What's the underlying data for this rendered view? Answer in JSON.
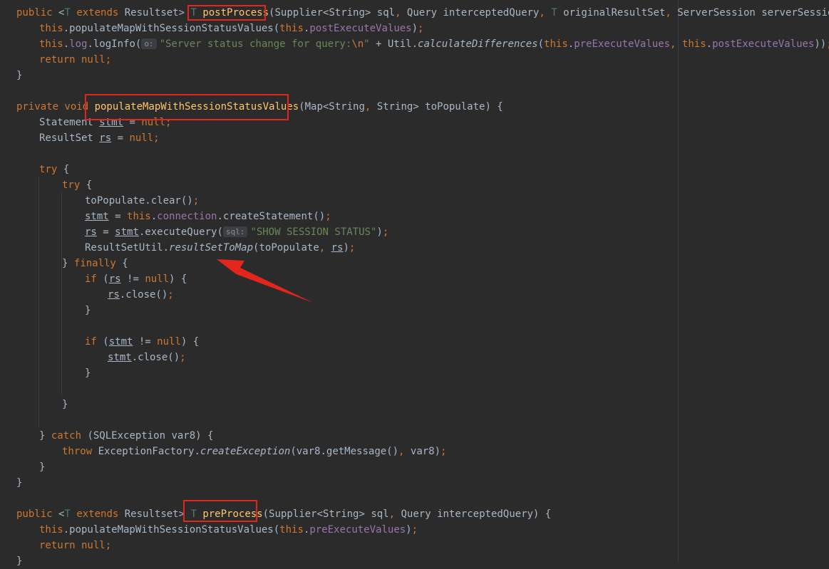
{
  "editor": {
    "lines": [
      {
        "indent": 0,
        "segments": [
          {
            "t": "public ",
            "c": "kw"
          },
          {
            "t": "<",
            "c": ""
          },
          {
            "t": "T",
            "c": "typeparam"
          },
          {
            "t": " extends ",
            "c": "kw"
          },
          {
            "t": "Resultset> ",
            "c": ""
          },
          {
            "t": "T ",
            "c": "typeparam"
          },
          {
            "t": "postProcess",
            "c": "fn"
          },
          {
            "t": "(Supplier<String> sql",
            "c": ""
          },
          {
            "t": ", ",
            "c": "kw"
          },
          {
            "t": "Query interceptedQuery",
            "c": ""
          },
          {
            "t": ", ",
            "c": "kw"
          },
          {
            "t": "T ",
            "c": "typeparam"
          },
          {
            "t": "originalResultSet",
            "c": ""
          },
          {
            "t": ", ",
            "c": "kw"
          },
          {
            "t": "ServerSession serverSession) {",
            "c": ""
          }
        ]
      },
      {
        "indent": 1,
        "segments": [
          {
            "t": "this",
            "c": "kw"
          },
          {
            "t": ".populateMapWithSessionStatusValues(",
            "c": ""
          },
          {
            "t": "this",
            "c": "kw"
          },
          {
            "t": ".",
            "c": ""
          },
          {
            "t": "postExecuteValues",
            "c": "field"
          },
          {
            "t": ")",
            "c": ""
          },
          {
            "t": ";",
            "c": "kw"
          }
        ]
      },
      {
        "indent": 1,
        "segments": [
          {
            "t": "this",
            "c": "kw"
          },
          {
            "t": ".",
            "c": ""
          },
          {
            "t": "log",
            "c": "field"
          },
          {
            "t": ".logInfo(",
            "c": ""
          },
          {
            "t": "o:",
            "c": "hint"
          },
          {
            "t": "\"Server status change for query:",
            "c": "str"
          },
          {
            "t": "\\n",
            "c": "esc"
          },
          {
            "t": "\"",
            "c": "str"
          },
          {
            "t": " + Util.",
            "c": ""
          },
          {
            "t": "calculateDifferences",
            "c": "italic"
          },
          {
            "t": "(",
            "c": ""
          },
          {
            "t": "this",
            "c": "kw"
          },
          {
            "t": ".",
            "c": ""
          },
          {
            "t": "preExecuteValues",
            "c": "field"
          },
          {
            "t": ", ",
            "c": "kw"
          },
          {
            "t": "this",
            "c": "kw"
          },
          {
            "t": ".",
            "c": ""
          },
          {
            "t": "postExecuteValues",
            "c": "field"
          },
          {
            "t": "))",
            "c": ""
          },
          {
            "t": ";",
            "c": "kw"
          }
        ]
      },
      {
        "indent": 1,
        "segments": [
          {
            "t": "return null",
            "c": "kw"
          },
          {
            "t": ";",
            "c": "kw"
          }
        ]
      },
      {
        "indent": 0,
        "segments": [
          {
            "t": "}",
            "c": ""
          }
        ]
      },
      {
        "indent": 0,
        "segments": []
      },
      {
        "indent": 0,
        "segments": [
          {
            "t": "private void ",
            "c": "kw"
          },
          {
            "t": "populateMapWithSessionStatusValues",
            "c": "fn"
          },
          {
            "t": "(Map<String",
            "c": ""
          },
          {
            "t": ", ",
            "c": "kw"
          },
          {
            "t": "String> toPopulate) {",
            "c": ""
          }
        ]
      },
      {
        "indent": 1,
        "segments": [
          {
            "t": "Statement ",
            "c": ""
          },
          {
            "t": "stmt",
            "c": "u"
          },
          {
            "t": " = ",
            "c": ""
          },
          {
            "t": "null",
            "c": "kw"
          },
          {
            "t": ";",
            "c": "kw"
          }
        ]
      },
      {
        "indent": 1,
        "segments": [
          {
            "t": "ResultSet ",
            "c": ""
          },
          {
            "t": "rs",
            "c": "u"
          },
          {
            "t": " = ",
            "c": ""
          },
          {
            "t": "null",
            "c": "kw"
          },
          {
            "t": ";",
            "c": "kw"
          }
        ]
      },
      {
        "indent": 0,
        "segments": []
      },
      {
        "indent": 1,
        "segments": [
          {
            "t": "try ",
            "c": "kw"
          },
          {
            "t": "{",
            "c": ""
          }
        ]
      },
      {
        "indent": 2,
        "segments": [
          {
            "t": "try ",
            "c": "kw"
          },
          {
            "t": "{",
            "c": ""
          }
        ]
      },
      {
        "indent": 3,
        "segments": [
          {
            "t": "toPopulate.clear()",
            "c": ""
          },
          {
            "t": ";",
            "c": "kw"
          }
        ]
      },
      {
        "indent": 3,
        "segments": [
          {
            "t": "stmt",
            "c": "u"
          },
          {
            "t": " = ",
            "c": ""
          },
          {
            "t": "this",
            "c": "kw"
          },
          {
            "t": ".",
            "c": ""
          },
          {
            "t": "connection",
            "c": "field"
          },
          {
            "t": ".createStatement()",
            "c": ""
          },
          {
            "t": ";",
            "c": "kw"
          }
        ]
      },
      {
        "indent": 3,
        "segments": [
          {
            "t": "rs",
            "c": "u"
          },
          {
            "t": " = ",
            "c": ""
          },
          {
            "t": "stmt",
            "c": "u"
          },
          {
            "t": ".executeQuery(",
            "c": ""
          },
          {
            "t": "sql:",
            "c": "hint"
          },
          {
            "t": "\"SHOW SESSION STATUS\"",
            "c": "str"
          },
          {
            "t": ")",
            "c": ""
          },
          {
            "t": ";",
            "c": "kw"
          }
        ]
      },
      {
        "indent": 3,
        "segments": [
          {
            "t": "ResultSetUtil.",
            "c": ""
          },
          {
            "t": "resultSetToMap",
            "c": "italic"
          },
          {
            "t": "(toPopulate",
            "c": ""
          },
          {
            "t": ", ",
            "c": "kw"
          },
          {
            "t": "rs",
            "c": "u"
          },
          {
            "t": ")",
            "c": ""
          },
          {
            "t": ";",
            "c": "kw"
          }
        ]
      },
      {
        "indent": 2,
        "segments": [
          {
            "t": "} ",
            "c": ""
          },
          {
            "t": "finally ",
            "c": "kw"
          },
          {
            "t": "{",
            "c": ""
          }
        ]
      },
      {
        "indent": 3,
        "segments": [
          {
            "t": "if ",
            "c": "kw"
          },
          {
            "t": "(",
            "c": ""
          },
          {
            "t": "rs",
            "c": "u"
          },
          {
            "t": " != ",
            "c": ""
          },
          {
            "t": "null",
            "c": "kw"
          },
          {
            "t": ") {",
            "c": ""
          }
        ]
      },
      {
        "indent": 4,
        "segments": [
          {
            "t": "rs",
            "c": "u"
          },
          {
            "t": ".close()",
            "c": ""
          },
          {
            "t": ";",
            "c": "kw"
          }
        ]
      },
      {
        "indent": 3,
        "segments": [
          {
            "t": "}",
            "c": ""
          }
        ]
      },
      {
        "indent": 0,
        "segments": []
      },
      {
        "indent": 3,
        "segments": [
          {
            "t": "if ",
            "c": "kw"
          },
          {
            "t": "(",
            "c": ""
          },
          {
            "t": "stmt",
            "c": "u"
          },
          {
            "t": " != ",
            "c": ""
          },
          {
            "t": "null",
            "c": "kw"
          },
          {
            "t": ") {",
            "c": ""
          }
        ]
      },
      {
        "indent": 4,
        "segments": [
          {
            "t": "stmt",
            "c": "u"
          },
          {
            "t": ".close()",
            "c": ""
          },
          {
            "t": ";",
            "c": "kw"
          }
        ]
      },
      {
        "indent": 3,
        "segments": [
          {
            "t": "}",
            "c": ""
          }
        ]
      },
      {
        "indent": 0,
        "segments": []
      },
      {
        "indent": 2,
        "segments": [
          {
            "t": "}",
            "c": ""
          }
        ]
      },
      {
        "indent": 0,
        "segments": []
      },
      {
        "indent": 1,
        "segments": [
          {
            "t": "} ",
            "c": ""
          },
          {
            "t": "catch ",
            "c": "kw"
          },
          {
            "t": "(SQLException var8) {",
            "c": ""
          }
        ]
      },
      {
        "indent": 2,
        "segments": [
          {
            "t": "throw ",
            "c": "kw"
          },
          {
            "t": "ExceptionFactory.",
            "c": ""
          },
          {
            "t": "createException",
            "c": "italic"
          },
          {
            "t": "(var8.getMessage()",
            "c": ""
          },
          {
            "t": ", ",
            "c": "kw"
          },
          {
            "t": "var8)",
            "c": ""
          },
          {
            "t": ";",
            "c": "kw"
          }
        ]
      },
      {
        "indent": 1,
        "segments": [
          {
            "t": "}",
            "c": ""
          }
        ]
      },
      {
        "indent": 0,
        "segments": [
          {
            "t": "}",
            "c": ""
          }
        ]
      },
      {
        "indent": 0,
        "segments": []
      },
      {
        "indent": 0,
        "segments": [
          {
            "t": "public ",
            "c": "kw"
          },
          {
            "t": "<",
            "c": ""
          },
          {
            "t": "T",
            "c": "typeparam"
          },
          {
            "t": " extends ",
            "c": "kw"
          },
          {
            "t": "Resultset> ",
            "c": ""
          },
          {
            "t": "T ",
            "c": "typeparam"
          },
          {
            "t": "preProcess",
            "c": "fn"
          },
          {
            "t": "(Supplier<String> sql",
            "c": ""
          },
          {
            "t": ", ",
            "c": "kw"
          },
          {
            "t": "Query interceptedQuery) {",
            "c": ""
          }
        ]
      },
      {
        "indent": 1,
        "segments": [
          {
            "t": "this",
            "c": "kw"
          },
          {
            "t": ".populateMapWithSessionStatusValues(",
            "c": ""
          },
          {
            "t": "this",
            "c": "kw"
          },
          {
            "t": ".",
            "c": ""
          },
          {
            "t": "preExecuteValues",
            "c": "field"
          },
          {
            "t": ")",
            "c": ""
          },
          {
            "t": ";",
            "c": "kw"
          }
        ]
      },
      {
        "indent": 1,
        "segments": [
          {
            "t": "return null",
            "c": "kw"
          },
          {
            "t": ";",
            "c": "kw"
          }
        ]
      },
      {
        "indent": 0,
        "segments": [
          {
            "t": "}",
            "c": ""
          }
        ]
      }
    ]
  },
  "colors": {
    "background": "#2b2b2b",
    "keyword": "#cc7832",
    "method_declaration": "#ffc66d",
    "field": "#9876aa",
    "string": "#6a8759",
    "type_parameter": "#507874",
    "default_text": "#a9b7c6",
    "annotation_highlight": "#e2261c"
  }
}
